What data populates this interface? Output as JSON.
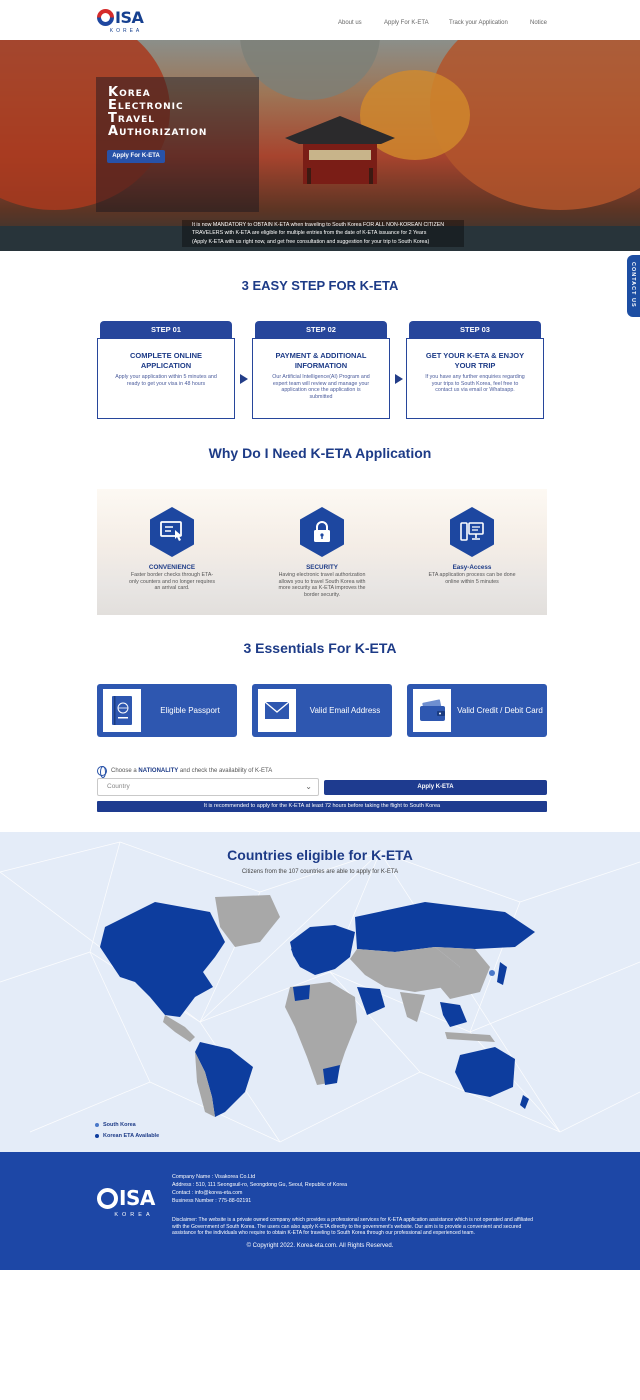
{
  "brand": {
    "logo_text": "ISA",
    "logo_sub": "KOREA"
  },
  "nav": [
    "About us",
    "Apply For K-ETA",
    "Track your Application",
    "Notice"
  ],
  "hero": {
    "title_lines": [
      {
        "cap": "K",
        "rest": "OREA"
      },
      {
        "cap": "E",
        "rest": "LECTRONIC"
      },
      {
        "cap": "T",
        "rest": "RAVEL"
      },
      {
        "cap": "A",
        "rest": "UTHORIZATION"
      }
    ],
    "apply_button": "Apply For K-ETA",
    "note_lines": [
      "It is now MANDATORY to OBTAIN K-ETA when traveling to South Korea FOR ALL NON-KOREAN CITIZEN",
      "TRAVELERS with K-ETA are eligible for multiple entries from the date of K-ETA issuance for 2 Years",
      "(Apply K-ETA with us right now, and get free consultation and suggestion for your trip to South Korea)"
    ]
  },
  "contact_tab": "CONTACT US",
  "steps_section": {
    "title": "3 EASY STEP FOR K-ETA",
    "steps": [
      {
        "label": "STEP 01",
        "heading": "COMPLETE ONLINE APPLICATION",
        "text": "Apply your application within 5 minutes and ready to get your visa in 48 hours"
      },
      {
        "label": "STEP 02",
        "heading": "PAYMENT & ADDITIONAL INFORMATION",
        "text": "Our Artificial Intelligence(AI) Program and expert team will review and manage your application once the application is submitted"
      },
      {
        "label": "STEP 03",
        "heading": "GET YOUR K-ETA & ENJOY YOUR TRIP",
        "text": "If you have any further enquiries regarding your trips to South Korea, feel free to contact us via email or Whatsapp."
      }
    ]
  },
  "why_section": {
    "title": "Why Do I Need K-ETA Application",
    "items": [
      {
        "icon": "monitor-touch-icon",
        "heading": "CONVENIENCE",
        "text": "Faster border checks through ETA-only counters and no longer requires an arrival card."
      },
      {
        "icon": "lock-icon",
        "heading": "SECURITY",
        "text": "Having electronic travel authorization allows you to travel South Korea with more security as K-ETA improves the border security."
      },
      {
        "icon": "computer-icon",
        "heading": "Easy-Access",
        "text": "ETA application process can be done online within 5 minutes"
      }
    ]
  },
  "essentials_section": {
    "title": "3 Essentials For K-ETA",
    "items": [
      {
        "icon": "passport-icon",
        "label": "Eligible Passport"
      },
      {
        "icon": "email-icon",
        "label": "Valid Email Address"
      },
      {
        "icon": "wallet-card-icon",
        "label": "Valid Credit / Debit Card"
      }
    ]
  },
  "nationality": {
    "prefix": "Choose a",
    "bold": "NATIONALITY",
    "suffix": "and check the availability of K-ETA",
    "select_value": "Country",
    "apply_button": "Apply K-ETA",
    "recommendation": "It is recommended to apply for the K-ETA at least 72 hours before taking the flight to South Korea"
  },
  "map_section": {
    "title": "Countries eligible for K-ETA",
    "subtitle": "Citizens from the 107 countries are able to apply for K-ETA",
    "legend": [
      {
        "label": "South Korea",
        "color": "#4a78c8"
      },
      {
        "label": "Korean ETA Available",
        "color": "#0d3d9e"
      }
    ],
    "colors": {
      "eligible": "#0d3d9e",
      "not_eligible": "#a8a8a8"
    }
  },
  "footer": {
    "info_lines": [
      "Company Name : Visakorea Co.Ltd",
      "Address : 510, 111 Seongsuil-ro, Seongdong Gu, Seoul, Republic of Korea",
      "Contact : info@korea-eta.com",
      "Business Number : 775-88-02191"
    ],
    "disclaimer": "Disclaimer: The website is a private owned company which provides a professional services for K-ETA application assistance which is not operated and affiliated with the Government of South Korea. The users can also apply K-ETA directly to the government's website. Our aim is to provide a convenient and secured assistance for the individuals who require to obtain K-ETA for traveling to South Korea through our professional and experienced team.",
    "copyright": "© Copyright 2022. Korea-eta.com. All Rights Reserved."
  },
  "colors": {
    "primary": "#1d47a6",
    "dark_blue": "#1d3b87",
    "accent_red": "#d52b2b"
  }
}
